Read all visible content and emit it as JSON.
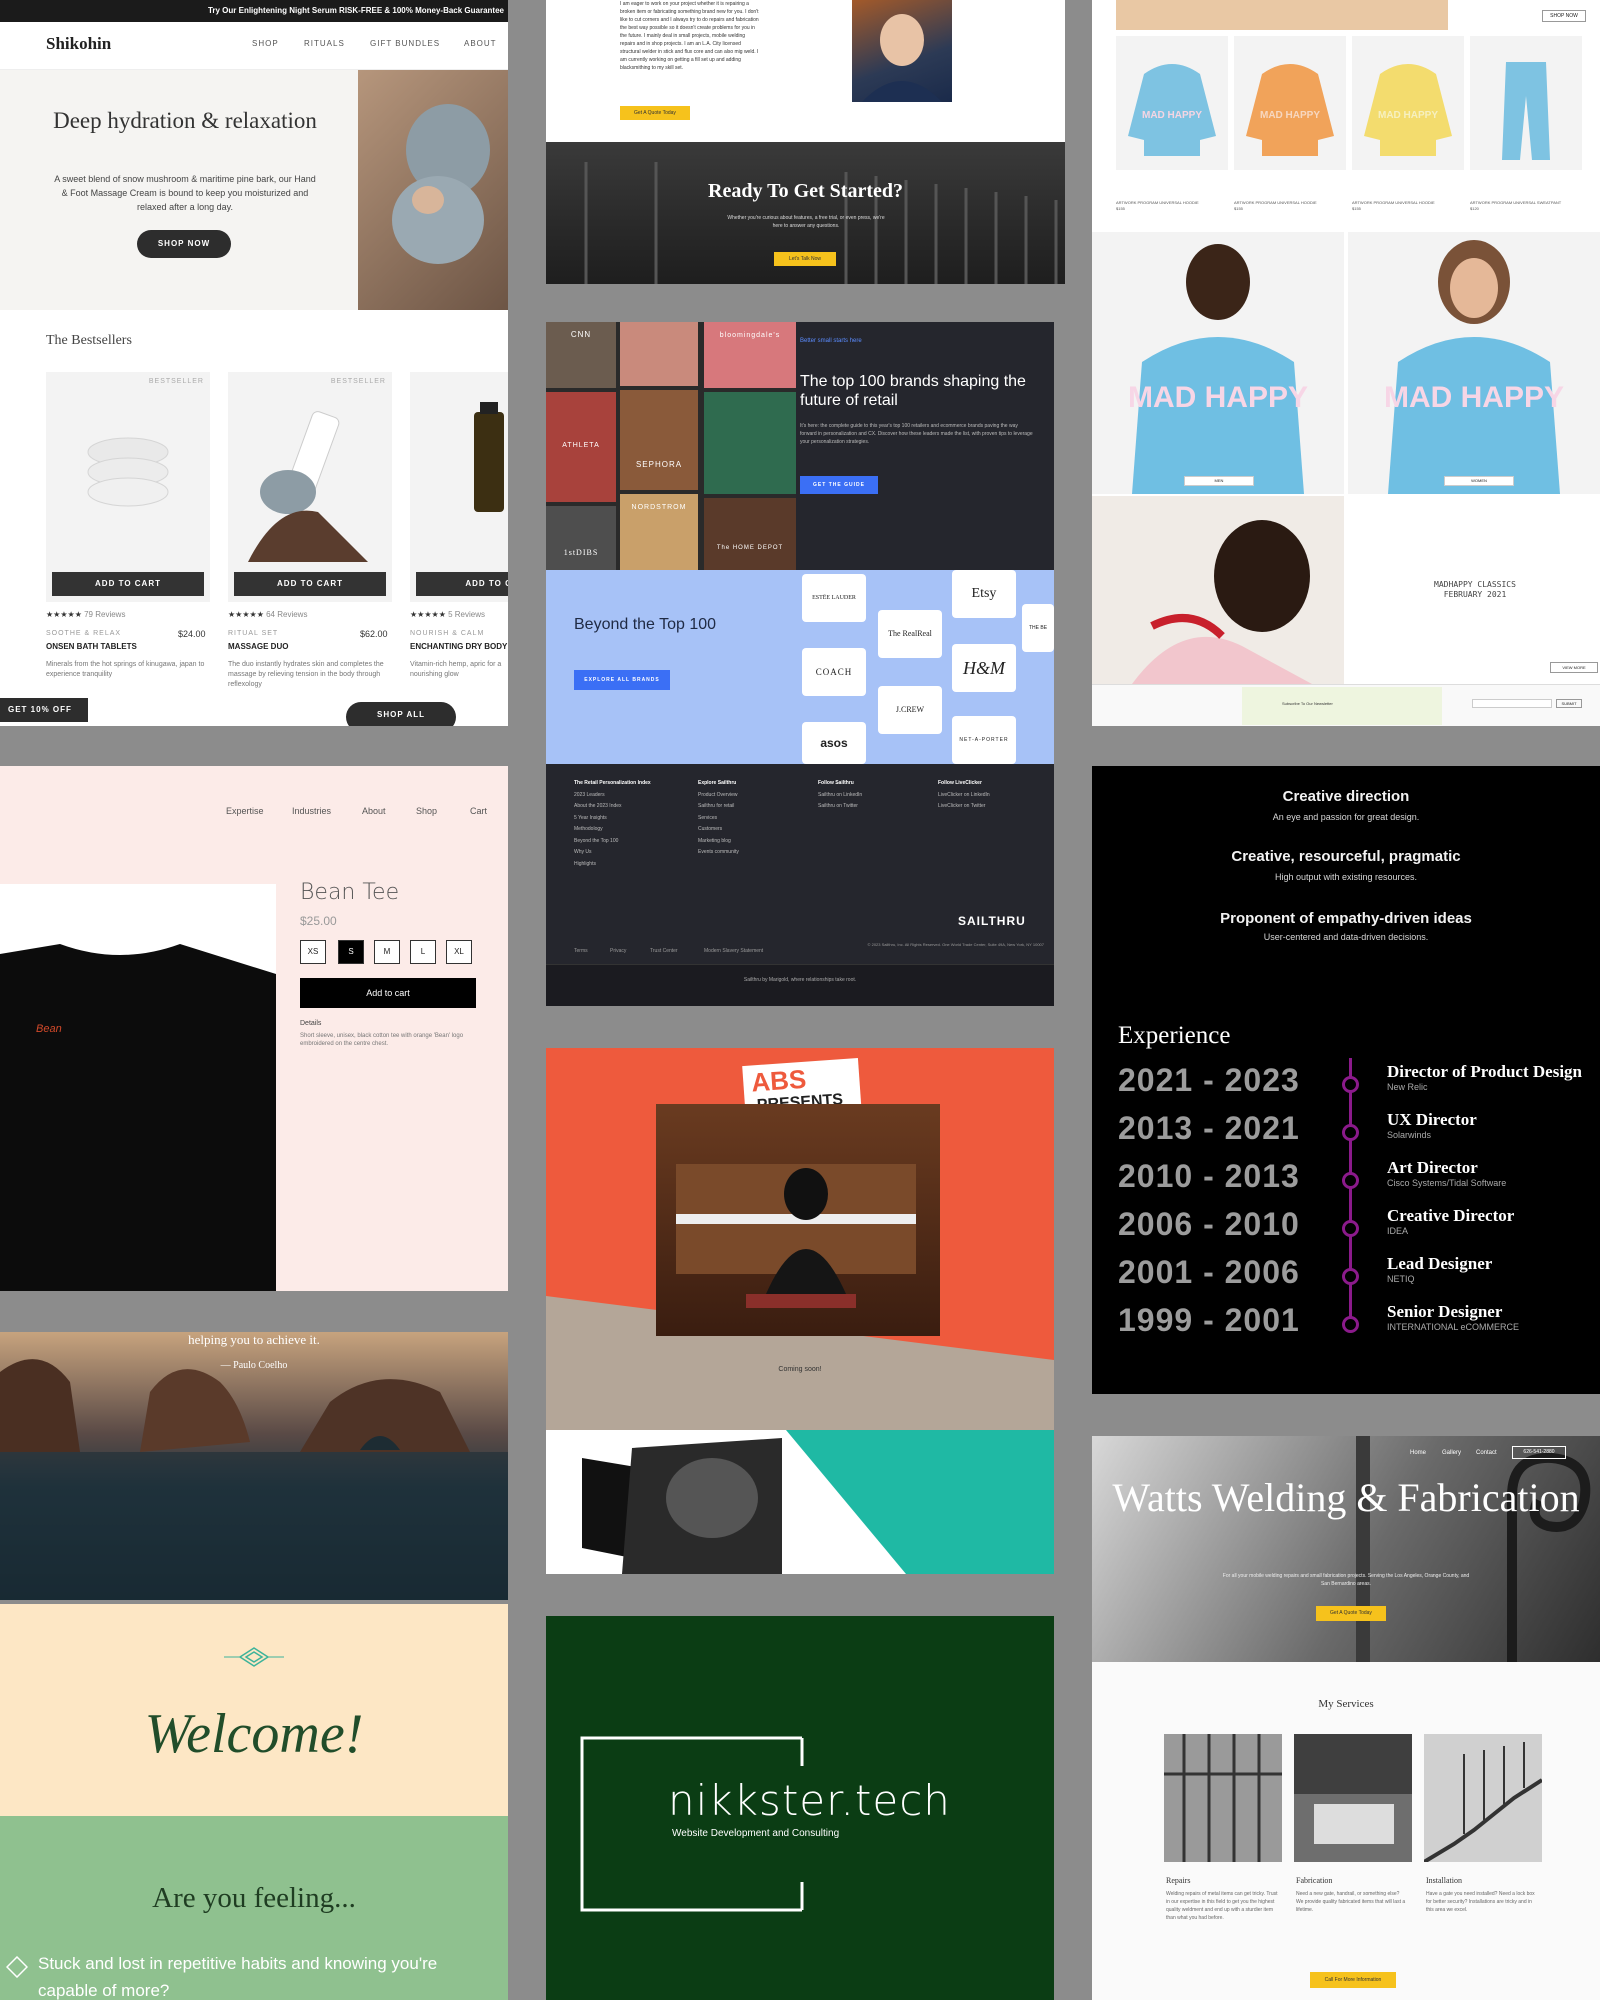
{
  "shikohin": {
    "banner": "Try Our Enlightening Night Serum RISK-FREE & 100% Money-Back Guarantee",
    "logo": "Shikohin",
    "nav": [
      "SHOP",
      "RITUALS",
      "GIFT BUNDLES",
      "ABOUT"
    ],
    "hero_title": "Deep hydration & relaxation",
    "hero_sub": "A sweet blend of snow mushroom & maritime pine bark, our Hand & Foot Massage Cream is bound to keep you moisturized and relaxed after a long day.",
    "shop_now": "SHOP NOW",
    "bestsellers": "The Bestsellers",
    "products": [
      {
        "badge": "BESTSELLER",
        "cta": "ADD TO CART",
        "stars": "★★★★★",
        "reviews": "79 Reviews",
        "category": "SOOTHE & RELAX",
        "price": "$24.00",
        "name": "ONSEN BATH TABLETS",
        "desc": "Minerals from the hot springs of kinugawa, japan to experience tranquility"
      },
      {
        "badge": "BESTSELLER",
        "cta": "ADD TO CART",
        "stars": "★★★★★",
        "reviews": "64 Reviews",
        "category": "RITUAL SET",
        "price": "$62.00",
        "name": "MASSAGE DUO",
        "desc": "The duo instantly hydrates skin and completes the massage by relieving tension in the body through reflexology"
      },
      {
        "badge": "",
        "cta": "ADD TO CA",
        "stars": "★★★★★",
        "reviews": "5 Reviews",
        "category": "NOURISH & CALM",
        "price": "",
        "name": "ENCHANTING DRY BODY",
        "desc": "Vitamin-rich hemp, apric for a nourishing glow"
      }
    ],
    "get_offer": "GET 10% OFF",
    "shop_all": "SHOP ALL"
  },
  "watts_top": {
    "bio": "I am eager to work on your project whether it is repairing a broken item or fabricating something brand new for you. I don't like to cut corners and I always try to do repairs and fabrication the best way possible so it doesn't create problems for you in the future. I mainly deal in small projects, mobile welding repairs and in shop projects. I am an L.A. City licensed structural welder in stick and flux core and can also mig weld. I am currently working on getting a fill set up and adding blacksmithing to my skill set.",
    "quote_btn": "Get A Quote Today",
    "ready": "Ready To Get Started?",
    "ready_sub": "Whether you're curious about features, a free trial, or even press, we're here to answer any questions.",
    "talk_btn": "Let's Talk Now"
  },
  "madhappy": {
    "shop_all": "SHOP NOW",
    "products": [
      {
        "label": "ARTWORK PROGRAM UNIVERSAL HOODIE",
        "price": "$155",
        "color": "#7ec3e2"
      },
      {
        "label": "ARTWORK PROGRAM UNIVERSAL HOODIE",
        "price": "$155",
        "color": "#f1a35a"
      },
      {
        "label": "ARTWORK PROGRAM UNIVERSAL HOODIE",
        "price": "$155",
        "color": "#f3dc6e"
      },
      {
        "label": "ARTWORK PROGRAM UNIVERSAL SWEATPANT",
        "price": "$120",
        "color": "#7ec3e2"
      }
    ],
    "print": "MAD HAPPY",
    "tag_men": "MEN",
    "tag_women": "WOMEN",
    "classics_1": "MADHAPPY CLASSICS",
    "classics_2": "FEBRUARY 2021",
    "view_more": "VIEW MORE",
    "subscribe": "Subscribe To Our Newsletter",
    "footer_submit": "SUBMIT"
  },
  "sailthru": {
    "tiles": [
      "CNN",
      "bloomingdale's",
      "SEPHORA",
      "ATHLETA",
      "NORDSTROM",
      "1stDIBS",
      "The HOME DEPOT"
    ],
    "kicker": "Better small starts here",
    "headline": "The top 100 brands shaping the future of retail",
    "body": "It's here: the complete guide to this year's top 100 retailers and ecommerce brands paving the way forward in personalization and CX. Discover how these leaders made the list, with proven tips to leverage your personalization strategies.",
    "guide_btn": "GET THE GUIDE",
    "beyond": "Beyond the Top 100",
    "explore_btn": "EXPLORE ALL BRANDS",
    "logos": [
      "ESTĒE LAUDER",
      "Etsy",
      "THE BE",
      "The RealReal",
      "COACH",
      "H&M",
      "J.CREW",
      "asos",
      "NET-A-PORTER"
    ],
    "footer_cols": [
      {
        "head": "The Retail Personalization Index",
        "items": [
          "2023 Leaders",
          "About the 2023 Index",
          "5 Year Insights",
          "Methodology",
          "Beyond the Top 100",
          "Why Us",
          "Highlights"
        ]
      },
      {
        "head": "Explore Sailthru",
        "items": [
          "Product Overview",
          "Sailthru for retail",
          "Services",
          "Customers",
          "Marketing blog",
          "Events community"
        ]
      },
      {
        "head": "Follow Sailthru",
        "items": [
          "Sailthru on LinkedIn",
          "Sailthru on Twitter"
        ]
      },
      {
        "head": "Follow LiveClicker",
        "items": [
          "LiveClicker on LinkedIn",
          "LiveClicker on Twitter"
        ]
      }
    ],
    "brand": "SAILTHRU",
    "legal": [
      "Terms",
      "Privacy",
      "Trust Center",
      "Modern Slavery Statement"
    ],
    "copyright": "© 2023 Sailthru, Inc. All Rights Reserved. One World Trade Center, Suite 49A, New York, NY 10007",
    "marigold": "Sailthru by Marigold, where relationships take root."
  },
  "experience": {
    "pillars": [
      {
        "title": "Creative direction",
        "sub": "An eye and passion for great design."
      },
      {
        "title": "Creative, resourceful, pragmatic",
        "sub": "High output with existing resources."
      },
      {
        "title": "Proponent of empathy-driven ideas",
        "sub": "User-centered and data-driven decisions."
      }
    ],
    "heading": "Experience",
    "timeline": [
      {
        "years": "2021  - 2023",
        "role": "Director of Product Design",
        "company": "New Relic"
      },
      {
        "years": "2013  - 2021",
        "role": "UX Director",
        "company": "Solarwinds"
      },
      {
        "years": "2010  - 2013",
        "role": "Art Director",
        "company": "Cisco Systems/Tidal Software"
      },
      {
        "years": "2006 - 2010",
        "role": "Creative Director",
        "company": "IDEA"
      },
      {
        "years": "2001  - 2006",
        "role": "Lead Designer",
        "company": "NETIQ"
      },
      {
        "years": "1999  - 2001",
        "role": "Senior Designer",
        "company": "INTERNATIONAL eCOMMERCE"
      }
    ],
    "accent": "#8b1a8b"
  },
  "beantee": {
    "nav": [
      "Expertise",
      "Industries",
      "About",
      "Shop",
      "Cart"
    ],
    "name": "Bean Tee",
    "price": "$25.00",
    "sizes": [
      "XS",
      "S",
      "M",
      "L",
      "XL"
    ],
    "selected_size": "S",
    "add": "Add to cart",
    "details_label": "Details",
    "details": "Short sleeve, unisex, black cotton tee with orange 'Bean' logo embroidered on the centre chest.",
    "shirt_logo": "Bean"
  },
  "abs": {
    "logo_1": "ABS",
    "logo_2": "PRESENTS",
    "coming_soon": "Coming soon!",
    "accent": "#ee5a3d"
  },
  "paulo": {
    "quote": "helping you to achieve it.",
    "author": "— Paulo Coelho"
  },
  "welcome": {
    "word": "Welcome!",
    "feeling": "Are you feeling...",
    "stuck": "Stuck and lost in repetitive habits and knowing you're capable of more?"
  },
  "nikkster": {
    "name": "nikkster.tech",
    "sub": "Website Development and Consulting"
  },
  "watts_bottom": {
    "nav": [
      "Home",
      "Gallery",
      "Contact"
    ],
    "phone": "626-541-2880",
    "title": "Watts Welding & Fabrication",
    "sub": "For all your mobile welding repairs and small fabrication projects. Serving the Los Angeles, Orange County, and San Bernardino areas.",
    "quote_btn": "Get A Quote Today",
    "services_title": "My Services",
    "services": [
      {
        "name": "Repairs",
        "text": "Welding repairs of metal items can get tricky. Trust in our expertise in this field to get you the highest quality weldment and end up with a sturdier item than what you had before."
      },
      {
        "name": "Fabrication",
        "text": "Need a new gate, handrail, or something else? We provide quality fabricated items that will last a lifetime."
      },
      {
        "name": "Installation",
        "text": "Have a gate you need installed? Need a lock box for better security? Installations are tricky and in this area we excel."
      }
    ],
    "cta": "Call For More Information"
  }
}
